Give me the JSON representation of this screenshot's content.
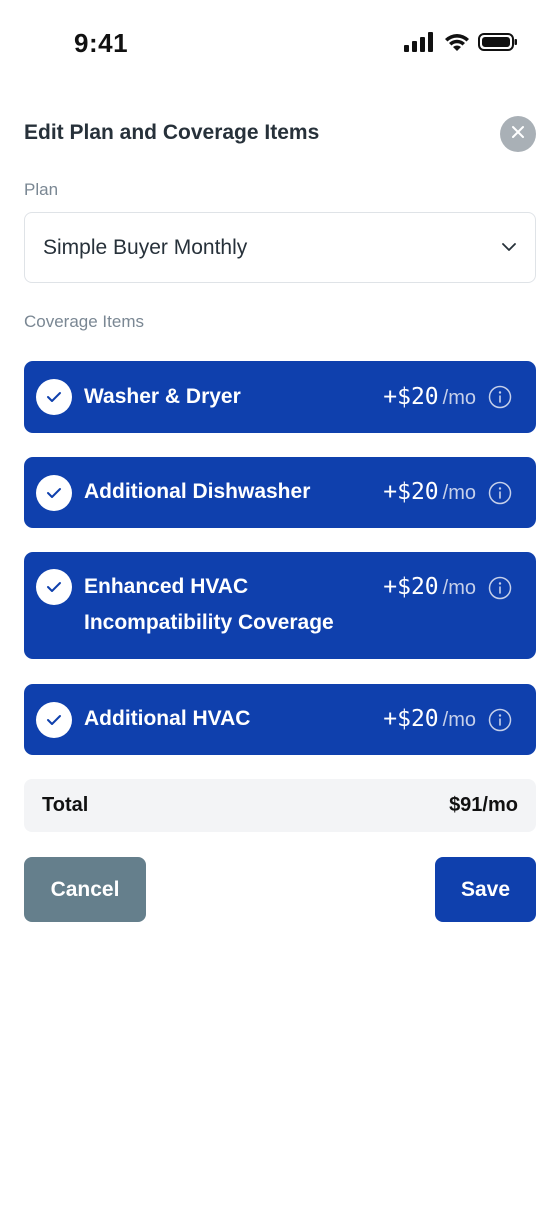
{
  "status_bar": {
    "time": "9:41",
    "icons": [
      "cellular-signal-icon",
      "wifi-icon",
      "battery-icon"
    ]
  },
  "header": {
    "title": "Edit Plan and Coverage Items",
    "close_icon": "close-icon"
  },
  "plan": {
    "label": "Plan",
    "selected": "Simple Buyer Monthly",
    "dropdown_icon": "chevron-down-icon"
  },
  "coverage": {
    "label": "Coverage Items",
    "items": [
      {
        "name": "Washer & Dryer",
        "name_line2": "",
        "price": "+$20",
        "unit": "/mo",
        "checked": true
      },
      {
        "name": "Additional Dishwasher",
        "name_line2": "",
        "price": "+$20",
        "unit": "/mo",
        "checked": true
      },
      {
        "name": "Enhanced HVAC",
        "name_line2": "Incompatibility Coverage",
        "price": "+$20",
        "unit": "/mo",
        "checked": true
      },
      {
        "name": "Additional HVAC",
        "name_line2": "",
        "price": "+$20",
        "unit": "/mo",
        "checked": true
      }
    ]
  },
  "total": {
    "label": "Total",
    "value": "$91/mo"
  },
  "actions": {
    "cancel_label": "Cancel",
    "save_label": "Save"
  },
  "colors": {
    "primary": "#0f40ad",
    "cancel": "#657f8c",
    "close_bg": "#a9b0b6",
    "total_bg": "#f3f4f6"
  }
}
